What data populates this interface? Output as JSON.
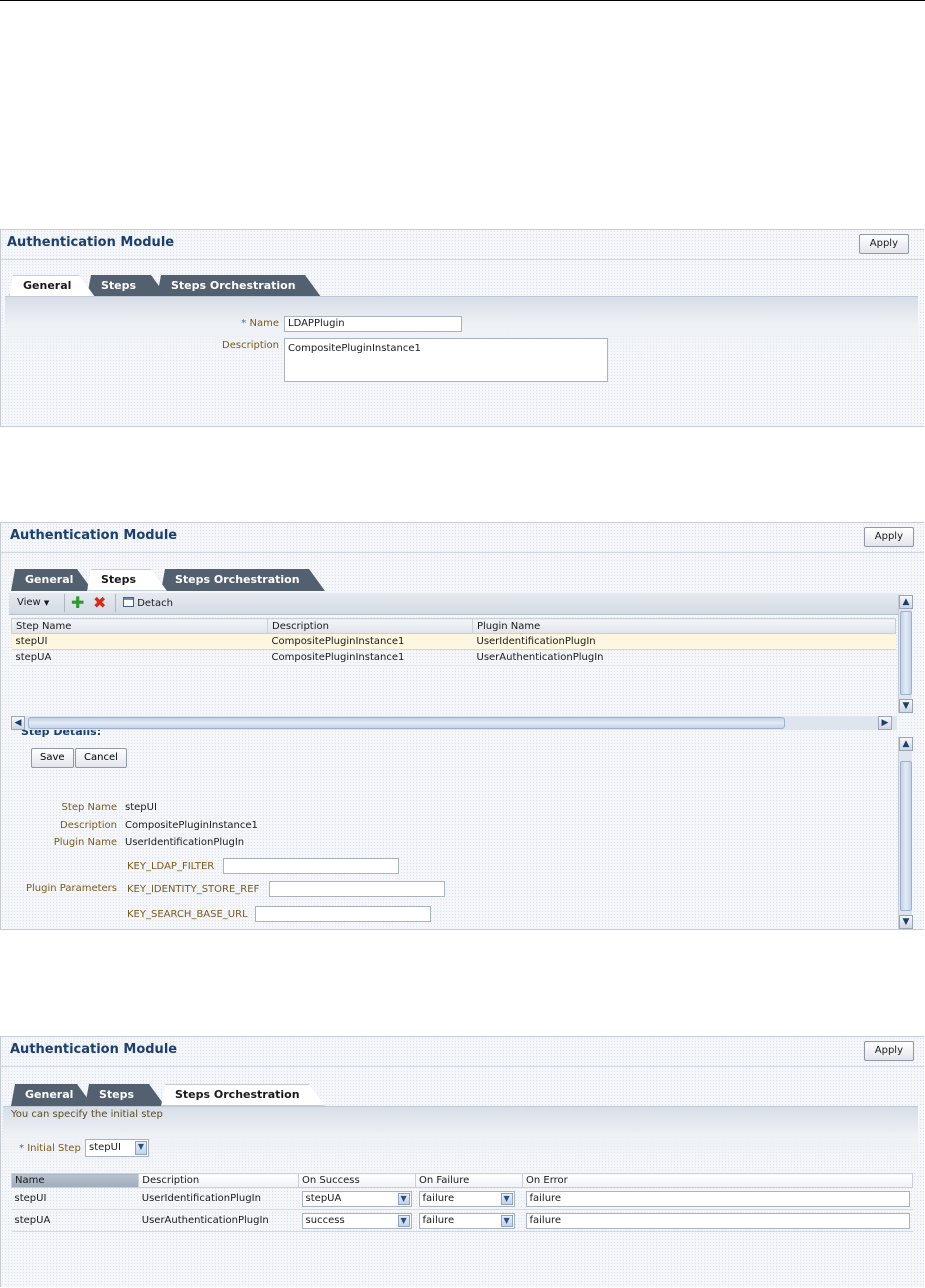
{
  "panel1": {
    "title": "Authentication Module",
    "apply_label": "Apply",
    "tabs": [
      {
        "label": "General",
        "active": true
      },
      {
        "label": "Steps",
        "active": false
      },
      {
        "label": "Steps Orchestration",
        "active": false
      }
    ],
    "form": {
      "name_required": "*",
      "name_label": "Name",
      "name_value": "LDAPPlugin",
      "description_label": "Description",
      "description_value": "CompositePluginInstance1"
    }
  },
  "panel2": {
    "title": "Authentication Module",
    "apply_label": "Apply",
    "tabs": [
      {
        "label": "General",
        "active": false
      },
      {
        "label": "Steps",
        "active": true
      },
      {
        "label": "Steps Orchestration",
        "active": false
      }
    ],
    "toolbar": {
      "view_label": "View",
      "add_icon": "green-plus-icon",
      "delete_icon": "red-x-icon",
      "detach_label": "Detach"
    },
    "table": {
      "columns": [
        "Step Name",
        "Description",
        "Plugin Name"
      ],
      "rows": [
        {
          "step_name": "stepUI",
          "description": "CompositePluginInstance1",
          "plugin_name": "UserIdentificationPlugIn"
        },
        {
          "step_name": "stepUA",
          "description": "CompositePluginInstance1",
          "plugin_name": "UserAuthenticationPlugIn"
        }
      ]
    },
    "details": {
      "heading": "Step Details:",
      "save_label": "Save",
      "cancel_label": "Cancel",
      "step_name_label": "Step Name",
      "step_name_value": "stepUI",
      "description_label": "Description",
      "description_value": "CompositePluginInstance1",
      "plugin_name_label": "Plugin Name",
      "plugin_name_value": "UserIdentificationPlugIn",
      "plugin_params_label": "Plugin Parameters",
      "params": [
        "KEY_LDAP_FILTER",
        "KEY_IDENTITY_STORE_REF",
        "KEY_SEARCH_BASE_URL"
      ]
    }
  },
  "panel3": {
    "title": "Authentication Module",
    "apply_label": "Apply",
    "tabs": [
      {
        "label": "General",
        "active": false
      },
      {
        "label": "Steps",
        "active": false
      },
      {
        "label": "Steps Orchestration",
        "active": true
      }
    ],
    "hint": "You can specify the initial step",
    "initial_step_required": "*",
    "initial_step_label": "Initial Step",
    "initial_step_value": "stepUI",
    "table": {
      "columns": [
        "Name",
        "Description",
        "On Success",
        "On Failure",
        "On Error"
      ],
      "rows": [
        {
          "name": "stepUI",
          "description": "UserIdentificationPlugIn",
          "on_success": "stepUA",
          "on_failure": "failure",
          "on_error": "failure"
        },
        {
          "name": "stepUA",
          "description": "UserAuthenticationPlugIn",
          "on_success": "success",
          "on_failure": "failure",
          "on_error": "failure"
        }
      ]
    }
  }
}
